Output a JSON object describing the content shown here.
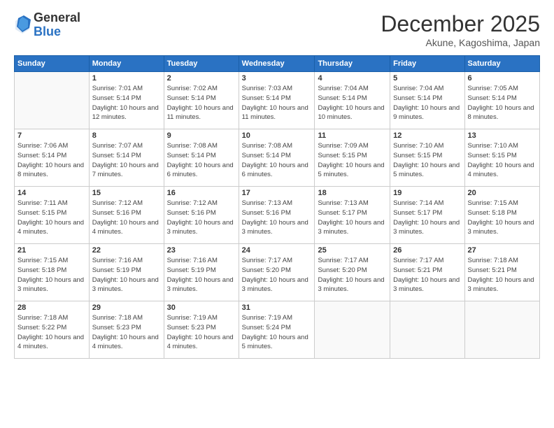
{
  "logo": {
    "general": "General",
    "blue": "Blue"
  },
  "header": {
    "month": "December 2025",
    "location": "Akune, Kagoshima, Japan"
  },
  "weekdays": [
    "Sunday",
    "Monday",
    "Tuesday",
    "Wednesday",
    "Thursday",
    "Friday",
    "Saturday"
  ],
  "weeks": [
    [
      null,
      {
        "day": "1",
        "sunrise": "7:01 AM",
        "sunset": "5:14 PM",
        "daylight": "10 hours and 12 minutes."
      },
      {
        "day": "2",
        "sunrise": "7:02 AM",
        "sunset": "5:14 PM",
        "daylight": "10 hours and 11 minutes."
      },
      {
        "day": "3",
        "sunrise": "7:03 AM",
        "sunset": "5:14 PM",
        "daylight": "10 hours and 11 minutes."
      },
      {
        "day": "4",
        "sunrise": "7:04 AM",
        "sunset": "5:14 PM",
        "daylight": "10 hours and 10 minutes."
      },
      {
        "day": "5",
        "sunrise": "7:04 AM",
        "sunset": "5:14 PM",
        "daylight": "10 hours and 9 minutes."
      },
      {
        "day": "6",
        "sunrise": "7:05 AM",
        "sunset": "5:14 PM",
        "daylight": "10 hours and 8 minutes."
      }
    ],
    [
      {
        "day": "7",
        "sunrise": "7:06 AM",
        "sunset": "5:14 PM",
        "daylight": "10 hours and 8 minutes."
      },
      {
        "day": "8",
        "sunrise": "7:07 AM",
        "sunset": "5:14 PM",
        "daylight": "10 hours and 7 minutes."
      },
      {
        "day": "9",
        "sunrise": "7:08 AM",
        "sunset": "5:14 PM",
        "daylight": "10 hours and 6 minutes."
      },
      {
        "day": "10",
        "sunrise": "7:08 AM",
        "sunset": "5:14 PM",
        "daylight": "10 hours and 6 minutes."
      },
      {
        "day": "11",
        "sunrise": "7:09 AM",
        "sunset": "5:15 PM",
        "daylight": "10 hours and 5 minutes."
      },
      {
        "day": "12",
        "sunrise": "7:10 AM",
        "sunset": "5:15 PM",
        "daylight": "10 hours and 5 minutes."
      },
      {
        "day": "13",
        "sunrise": "7:10 AM",
        "sunset": "5:15 PM",
        "daylight": "10 hours and 4 minutes."
      }
    ],
    [
      {
        "day": "14",
        "sunrise": "7:11 AM",
        "sunset": "5:15 PM",
        "daylight": "10 hours and 4 minutes."
      },
      {
        "day": "15",
        "sunrise": "7:12 AM",
        "sunset": "5:16 PM",
        "daylight": "10 hours and 4 minutes."
      },
      {
        "day": "16",
        "sunrise": "7:12 AM",
        "sunset": "5:16 PM",
        "daylight": "10 hours and 3 minutes."
      },
      {
        "day": "17",
        "sunrise": "7:13 AM",
        "sunset": "5:16 PM",
        "daylight": "10 hours and 3 minutes."
      },
      {
        "day": "18",
        "sunrise": "7:13 AM",
        "sunset": "5:17 PM",
        "daylight": "10 hours and 3 minutes."
      },
      {
        "day": "19",
        "sunrise": "7:14 AM",
        "sunset": "5:17 PM",
        "daylight": "10 hours and 3 minutes."
      },
      {
        "day": "20",
        "sunrise": "7:15 AM",
        "sunset": "5:18 PM",
        "daylight": "10 hours and 3 minutes."
      }
    ],
    [
      {
        "day": "21",
        "sunrise": "7:15 AM",
        "sunset": "5:18 PM",
        "daylight": "10 hours and 3 minutes."
      },
      {
        "day": "22",
        "sunrise": "7:16 AM",
        "sunset": "5:19 PM",
        "daylight": "10 hours and 3 minutes."
      },
      {
        "day": "23",
        "sunrise": "7:16 AM",
        "sunset": "5:19 PM",
        "daylight": "10 hours and 3 minutes."
      },
      {
        "day": "24",
        "sunrise": "7:17 AM",
        "sunset": "5:20 PM",
        "daylight": "10 hours and 3 minutes."
      },
      {
        "day": "25",
        "sunrise": "7:17 AM",
        "sunset": "5:20 PM",
        "daylight": "10 hours and 3 minutes."
      },
      {
        "day": "26",
        "sunrise": "7:17 AM",
        "sunset": "5:21 PM",
        "daylight": "10 hours and 3 minutes."
      },
      {
        "day": "27",
        "sunrise": "7:18 AM",
        "sunset": "5:21 PM",
        "daylight": "10 hours and 3 minutes."
      }
    ],
    [
      {
        "day": "28",
        "sunrise": "7:18 AM",
        "sunset": "5:22 PM",
        "daylight": "10 hours and 4 minutes."
      },
      {
        "day": "29",
        "sunrise": "7:18 AM",
        "sunset": "5:23 PM",
        "daylight": "10 hours and 4 minutes."
      },
      {
        "day": "30",
        "sunrise": "7:19 AM",
        "sunset": "5:23 PM",
        "daylight": "10 hours and 4 minutes."
      },
      {
        "day": "31",
        "sunrise": "7:19 AM",
        "sunset": "5:24 PM",
        "daylight": "10 hours and 5 minutes."
      },
      null,
      null,
      null
    ]
  ],
  "labels": {
    "sunrise": "Sunrise:",
    "sunset": "Sunset:",
    "daylight": "Daylight:"
  }
}
